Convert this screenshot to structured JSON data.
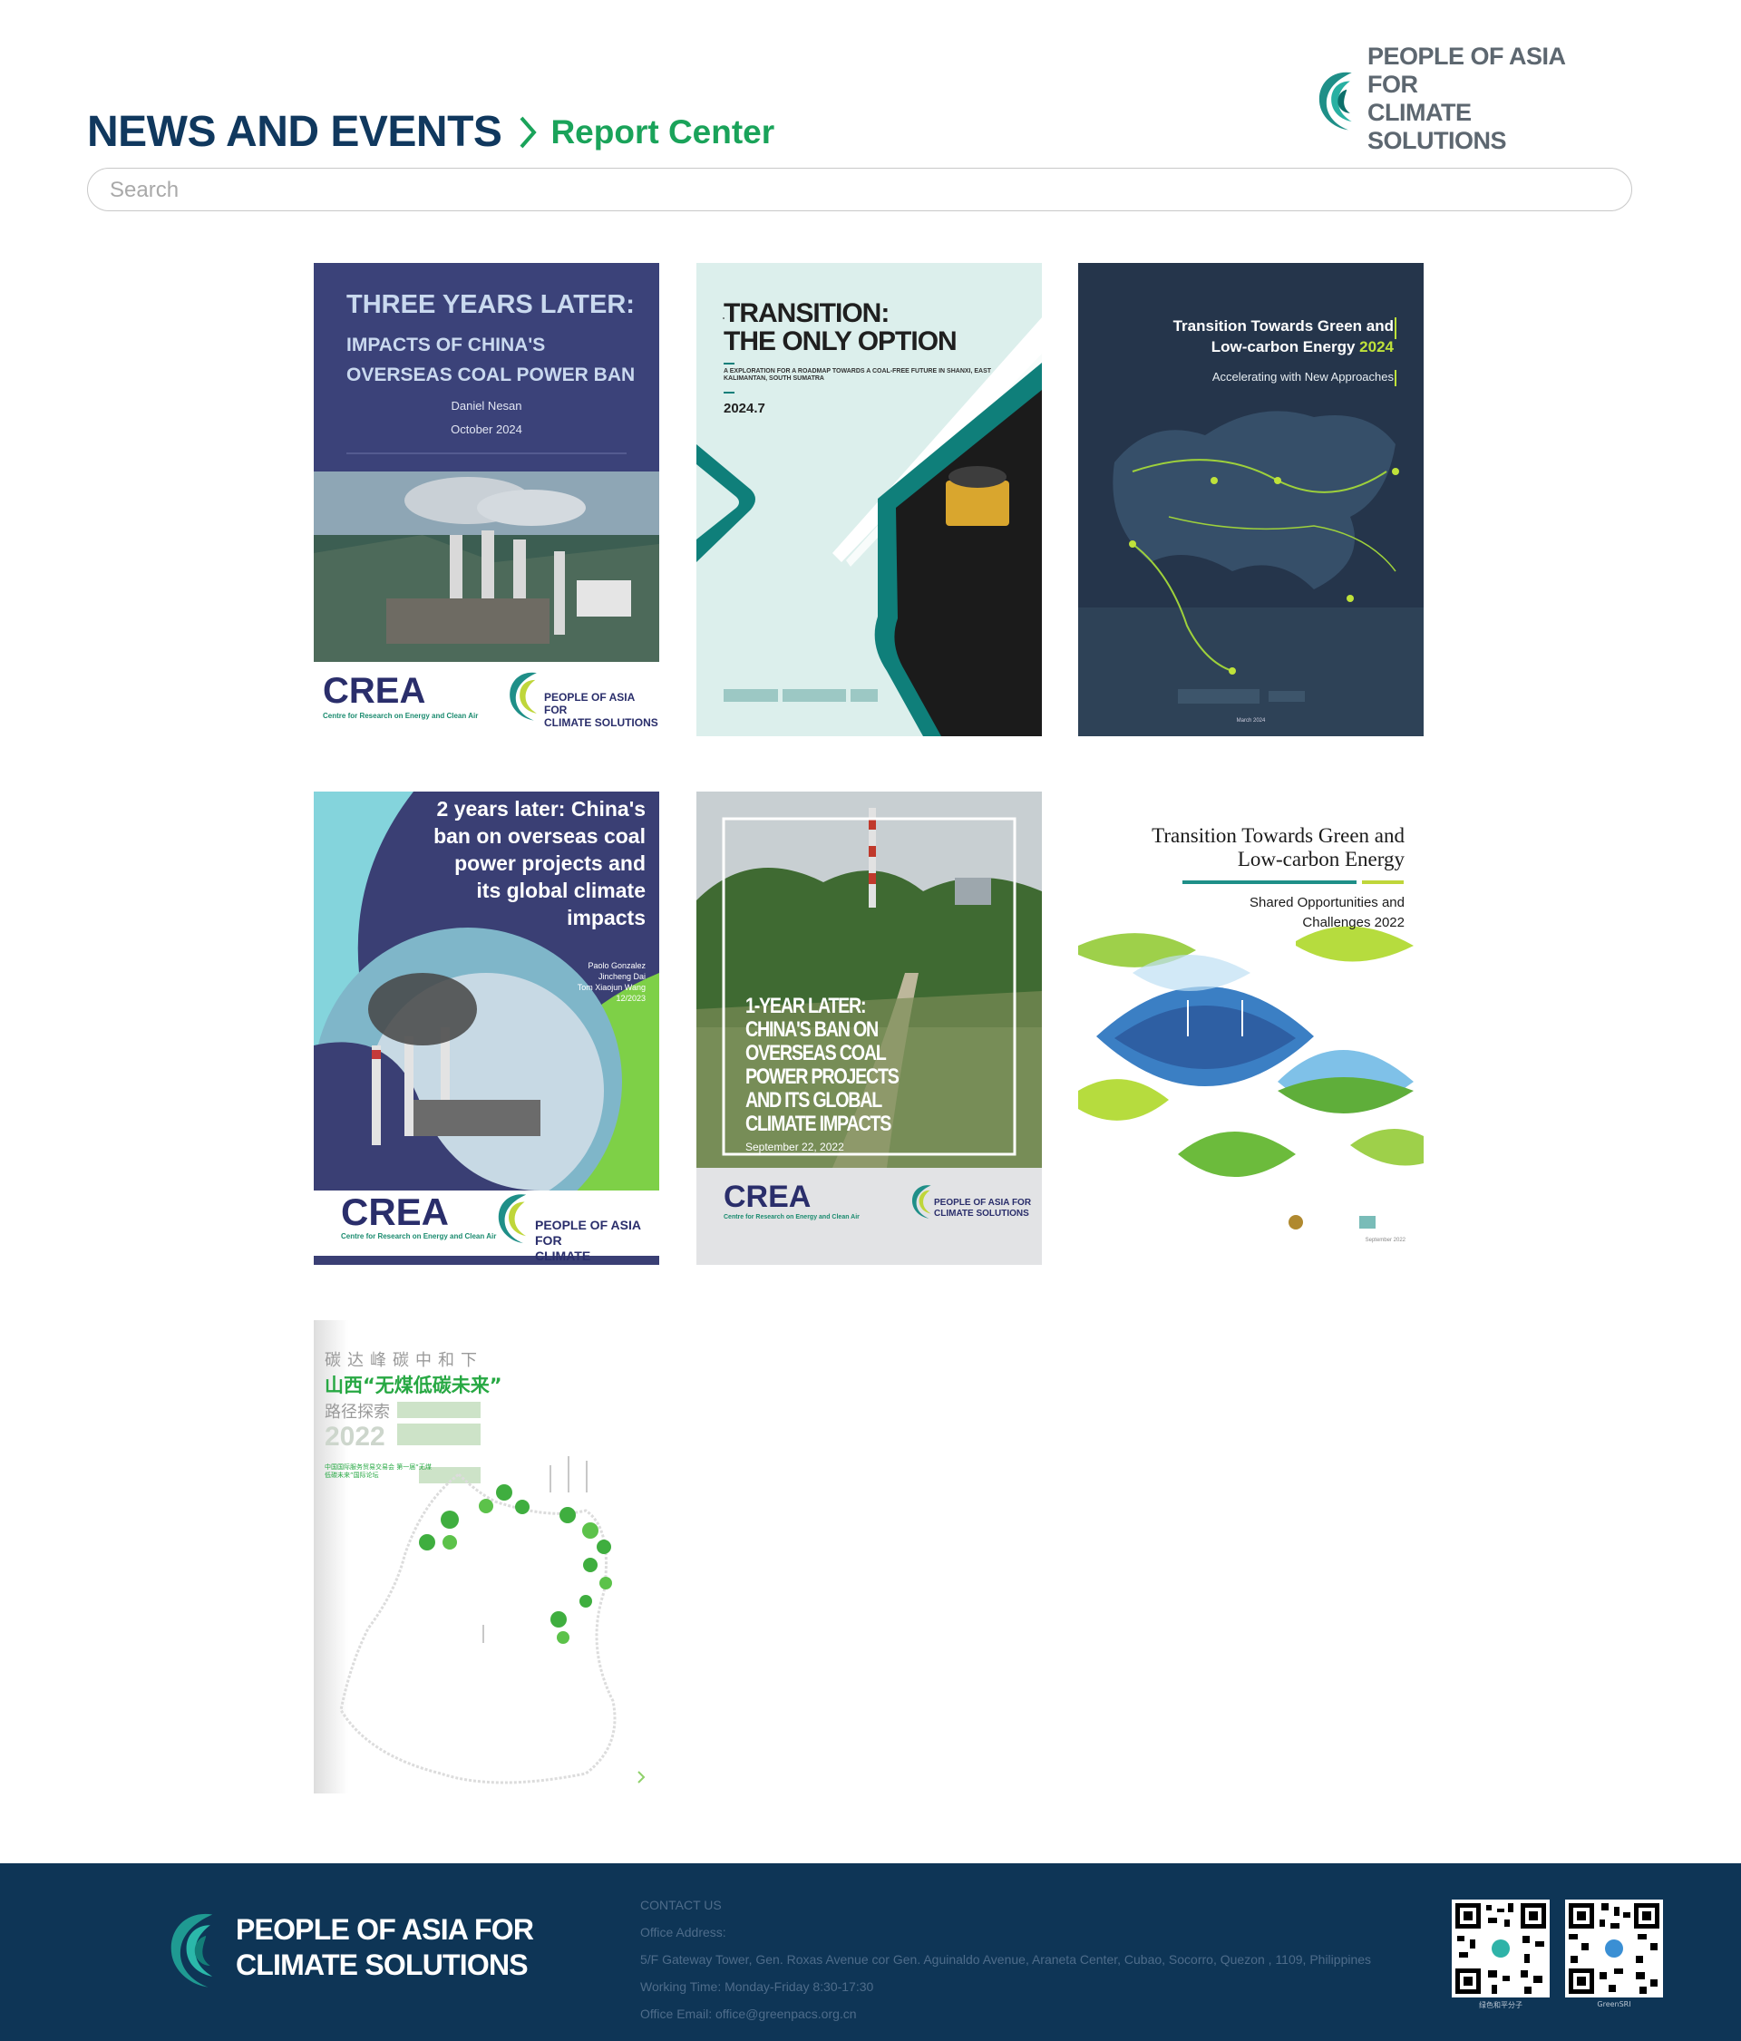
{
  "header": {
    "logo_line1": "PEOPLE OF ASIA FOR",
    "logo_line2": "CLIMATE SOLUTIONS",
    "title": "NEWS AND EVENTS",
    "subtitle": "Report Center"
  },
  "search": {
    "placeholder": "Search"
  },
  "reports": [
    {
      "title": "THREE YEARS LATER:",
      "subtitle": "IMPACTS OF CHINA'S OVERSEAS COAL POWER BAN",
      "author": "Daniel Nesan",
      "date": "October 2024",
      "org1": "CREA",
      "org1_sub": "Centre for Research on Energy and Clean Air",
      "org2_line1": "PEOPLE OF ASIA FOR",
      "org2_line2": "CLIMATE SOLUTIONS"
    },
    {
      "title_line1": "TRANSITION:",
      "title_line2": "THE ONLY OPTION",
      "subtitle": "A EXPLORATION FOR A ROADMAP TOWARDS A COAL-FREE FUTURE IN SHANXI, EAST KALIMANTAN, SOUTH SUMATRA",
      "date": "2024.7"
    },
    {
      "title_line1": "Transition Towards Green and",
      "title_line2a": "Low-carbon Energy ",
      "title_year": "2024",
      "subtitle": "Accelerating with New Approaches",
      "date": "March 2024"
    },
    {
      "title_line1": "2 years later: China's",
      "title_line2": "ban on overseas coal",
      "title_line3": "power projects and",
      "title_line4": "its global climate",
      "title_line5": "impacts",
      "author1": "Paolo Gonzalez",
      "author2": "Jincheng Dai",
      "author3": "Tom Xiaojun Wang",
      "date": "12/2023",
      "org1": "CREA",
      "org1_sub": "Centre for Research on Energy and Clean Air",
      "org2_line1": "PEOPLE OF ASIA FOR",
      "org2_line2": "CLIMATE SOLUTIONS"
    },
    {
      "title_line1": "1-YEAR LATER:",
      "title_line2": "CHINA'S BAN ON",
      "title_line3": "OVERSEAS COAL",
      "title_line4": "POWER PROJECTS",
      "title_line5": "AND ITS GLOBAL",
      "title_line6": "CLIMATE IMPACTS",
      "date": "September 22, 2022",
      "org1": "CREA",
      "org1_sub": "Centre for Research on Energy and Clean Air",
      "org2_line1": "PEOPLE OF ASIA FOR",
      "org2_line2": "CLIMATE SOLUTIONS"
    },
    {
      "title_line1": "Transition Towards Green and",
      "title_line2": "Low-carbon Energy",
      "subtitle_line1": "Shared Opportunities and",
      "subtitle_line2": "Challenges 2022",
      "date": "September 2022"
    },
    {
      "line1": "碳达峰碳中和下",
      "line2": "山西“无煤低碳未来”",
      "line3": "路径探索",
      "year": "2022",
      "note": "中国国际服务贸易交易会 第一届“无煤低碳未来”国际论坛"
    }
  ],
  "footer": {
    "logo_line1": "PEOPLE OF ASIA FOR",
    "logo_line2": "CLIMATE SOLUTIONS",
    "contact_heading": "CONTACT US",
    "address_label": "Office Address:",
    "address": "5/F Gateway Tower, Gen. Roxas Avenue cor Gen. Aguinaldo Avenue, Araneta Center, Cubao, Socorro, Quezon , 1109, Philippines",
    "hours": "Working Time: Monday-Friday 8:30-17:30",
    "email": "Office Email: office@greenpacs.org.cn",
    "qr1_caption": "绿色和平分子",
    "qr2_caption": "GreenSRI"
  },
  "colors": {
    "navy": "#10385e",
    "green": "#1aa35a",
    "footer_bg": "#0e3556",
    "teal": "#1f8f88"
  }
}
